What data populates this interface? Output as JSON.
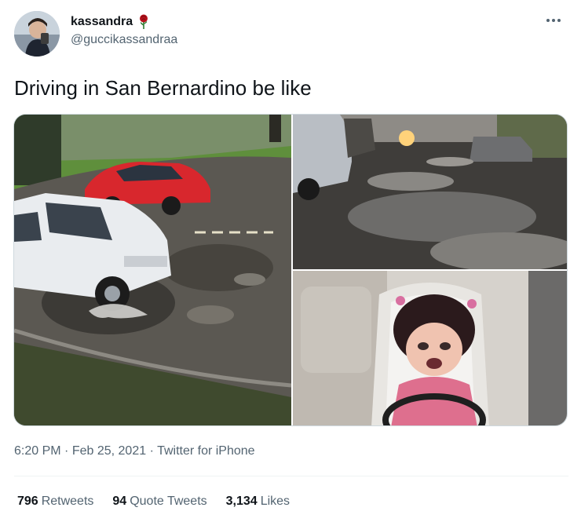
{
  "tweet": {
    "display_name": "kassandra",
    "handle": "@guccikassandraa",
    "text": "Driving in San Bernardino be like",
    "time": "6:20 PM",
    "date": "Feb 25, 2021",
    "source": "Twitter for iPhone",
    "separator": "·"
  },
  "icons": {
    "avatar": "user-avatar-photo",
    "name_emoji": "rose-icon",
    "more": "more-options-icon"
  },
  "media": [
    {
      "name": "photo-car-pothole"
    },
    {
      "name": "photo-flooded-potholes-street"
    },
    {
      "name": "photo-crying-girl-driving"
    }
  ],
  "stats": {
    "retweets_count": "796",
    "retweets_label": "Retweets",
    "quotes_count": "94",
    "quotes_label": "Quote Tweets",
    "likes_count": "3,134",
    "likes_label": "Likes"
  },
  "colors": {
    "text_primary": "#0f1419",
    "text_secondary": "#536471",
    "border": "#cfd9de",
    "rose": "#b5121b"
  }
}
